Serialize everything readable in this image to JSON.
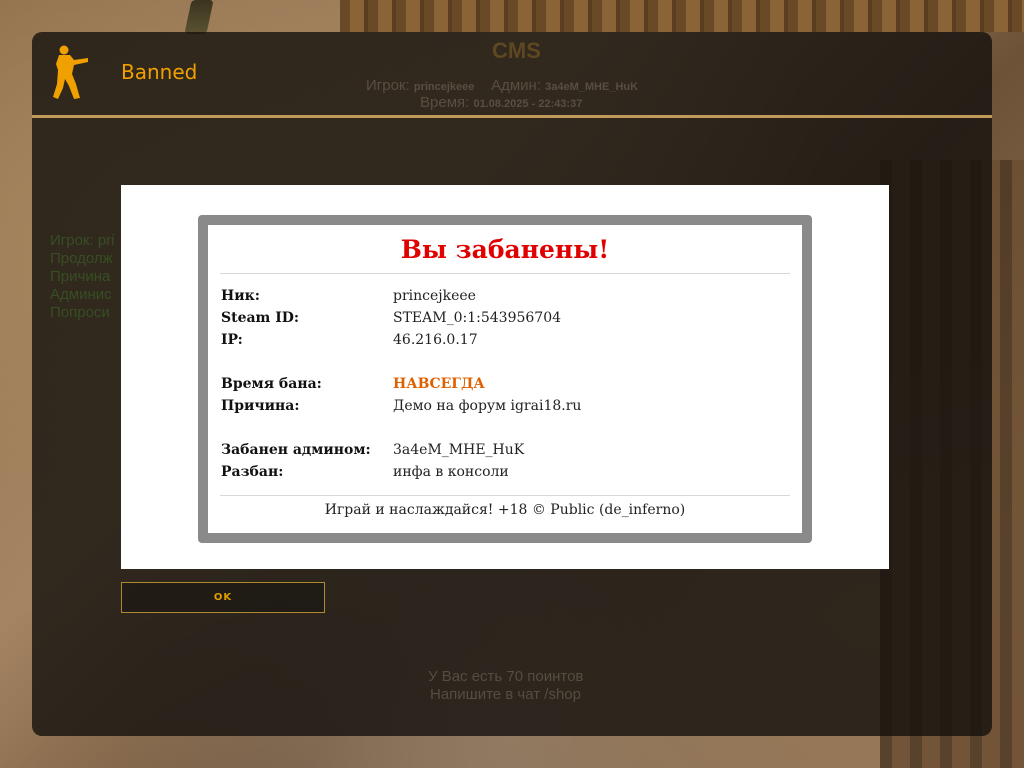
{
  "window": {
    "title": "Banned"
  },
  "background_hud": {
    "server_name": "CMS",
    "player_label": "Игрок:",
    "player_value": "princejkeee",
    "admin_label": "Админ:",
    "admin_value": "3a4eM_MHE_HuK",
    "time_label": "Время:",
    "time_value": "01.08.2025 - 22:43:37",
    "side_lines": [
      "Игрок: pri",
      "Продолж",
      "Причина",
      "Админис",
      "Попроси"
    ],
    "points_text": "У Вас есть 70 поинтов",
    "chat_text": "Напишите в чат /shop"
  },
  "ban": {
    "heading": "Вы забанены!",
    "nick_label": "Ник:",
    "nick_value": "princejkeee",
    "steam_label": "Steam ID:",
    "steam_value": "STEAM_0:1:543956704",
    "ip_label": "IP:",
    "ip_value": "46.216.0.17",
    "duration_label": "Время бана:",
    "duration_value": "НАВСЕГДА",
    "reason_label": "Причина:",
    "reason_value": "Демо на форум igrai18.ru",
    "admin_label": "Забанен админом:",
    "admin_value": "3a4eM_MHE_HuK",
    "unban_label": "Разбан:",
    "unban_value": "инфа в консоли",
    "footer": "Играй и наслаждайся! +18 © Public (de_inferno)"
  },
  "buttons": {
    "ok_label": "OK"
  },
  "colors": {
    "accent": "#f0a000",
    "heading_red": "#e00000",
    "forever_orange": "#e06000",
    "box_border": "#8a8a8a"
  }
}
